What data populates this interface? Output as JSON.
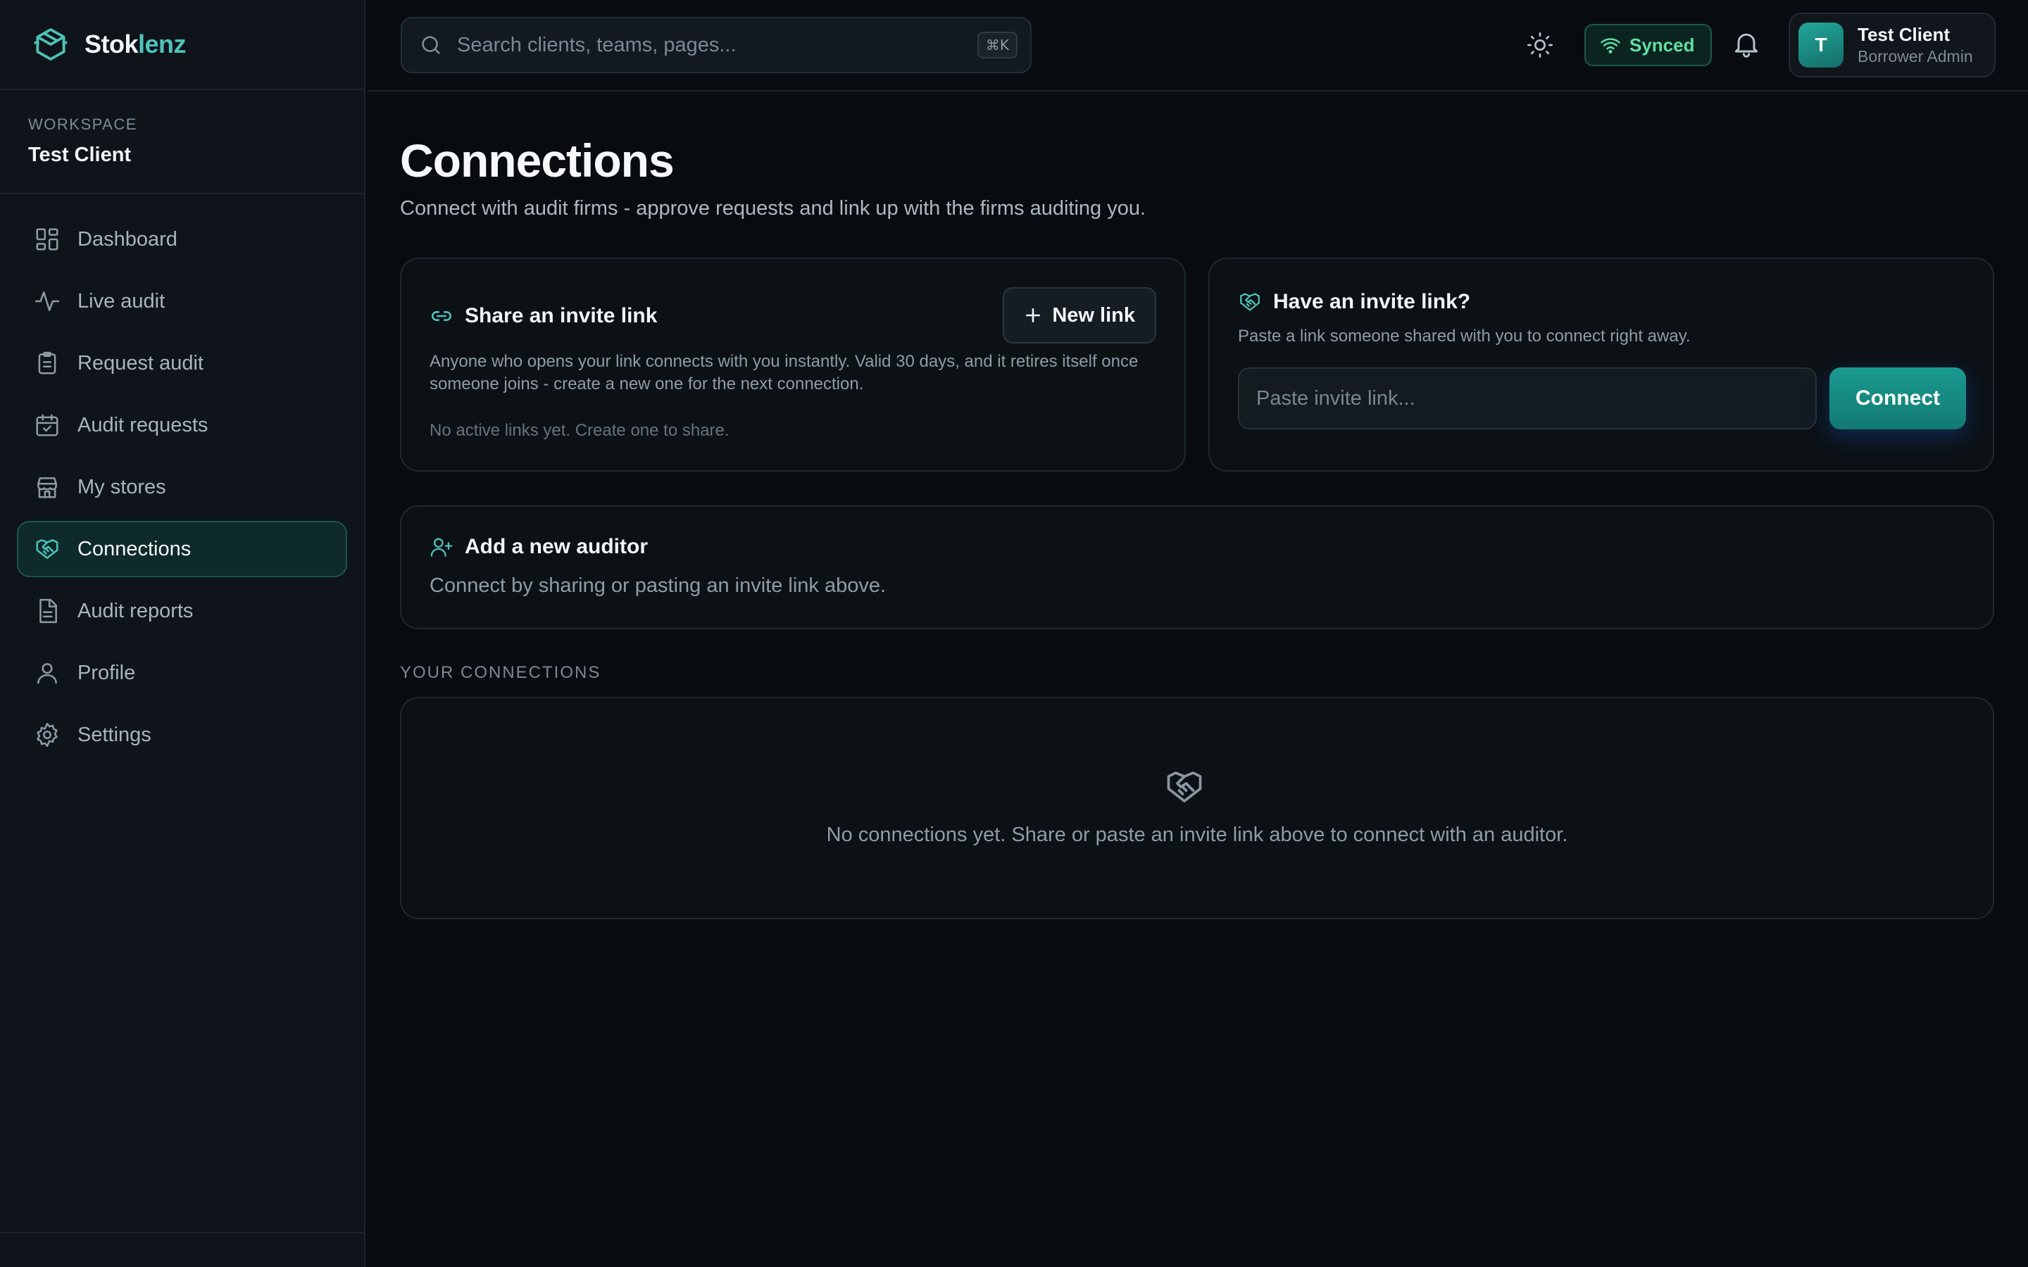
{
  "brand": {
    "name_part1": "Stok",
    "name_part2": "lenz",
    "icon": "box-icon"
  },
  "workspace": {
    "label": "WORKSPACE",
    "name": "Test Client"
  },
  "nav": [
    {
      "label": "Dashboard",
      "icon": "dashboard-icon"
    },
    {
      "label": "Live audit",
      "icon": "activity-icon"
    },
    {
      "label": "Request audit",
      "icon": "clipboard-icon"
    },
    {
      "label": "Audit requests",
      "icon": "calendar-check-icon"
    },
    {
      "label": "My stores",
      "icon": "store-icon"
    },
    {
      "label": "Connections",
      "icon": "handshake-icon",
      "active": true
    },
    {
      "label": "Audit reports",
      "icon": "file-text-icon"
    },
    {
      "label": "Profile",
      "icon": "user-icon"
    },
    {
      "label": "Settings",
      "icon": "gear-icon"
    }
  ],
  "topbar": {
    "search_placeholder": "Search clients, teams, pages...",
    "search_shortcut": "⌘K",
    "sync_status": "Synced",
    "user": {
      "initial": "T",
      "name": "Test Client",
      "role": "Borrower Admin"
    }
  },
  "page": {
    "title": "Connections",
    "subtitle": "Connect with audit firms - approve requests and link up with the firms auditing you."
  },
  "share_card": {
    "title": "Share an invite link",
    "button": "New link",
    "description": "Anyone who opens your link connects with you instantly. Valid 30 days, and it retires itself once someone joins - create a new one for the next connection.",
    "empty": "No active links yet. Create one to share."
  },
  "have_card": {
    "title": "Have an invite link?",
    "description": "Paste a link someone shared with you to connect right away.",
    "input_placeholder": "Paste invite link...",
    "button": "Connect"
  },
  "auditor_card": {
    "title": "Add a new auditor",
    "description": "Connect by sharing or pasting an invite link above."
  },
  "connections": {
    "section_label": "YOUR CONNECTIONS",
    "empty": "No connections yet. Share or paste an invite link above to connect with an auditor."
  },
  "colors": {
    "accent": "#4fc3b8",
    "background": "#080c10",
    "synced": "#5fe0a6"
  }
}
